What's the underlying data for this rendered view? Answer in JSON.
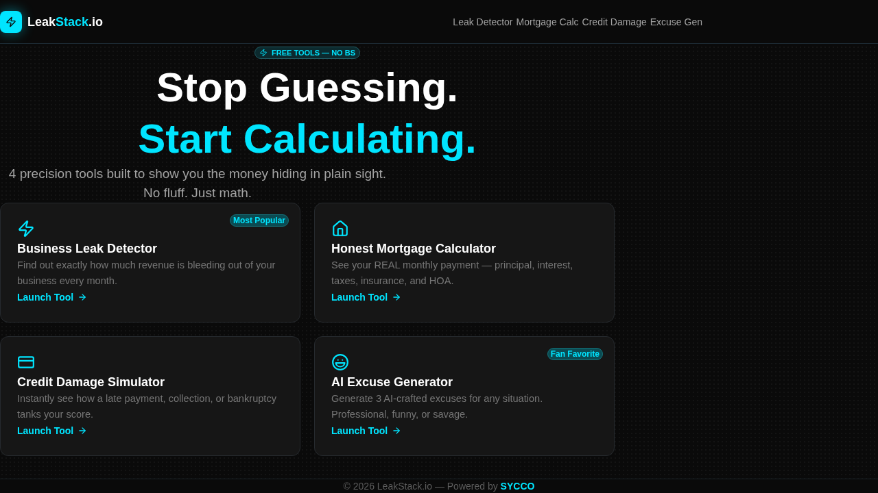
{
  "header": {
    "brand": [
      {
        "text": "Leak",
        "accent": false
      },
      {
        "text": "Stack",
        "accent": true
      },
      {
        "text": ".io",
        "accent": false
      }
    ],
    "nav": [
      "Leak Detector",
      "Mortgage Calc",
      "Credit Damage",
      "Excuse Gen"
    ]
  },
  "hero": {
    "tag": "FREE TOOLS — NO BS",
    "headline": [
      {
        "text": "Stop Guessing.",
        "accent": false
      },
      {
        "text": "Start Calculating.",
        "accent": true
      }
    ],
    "subtitle_lines": [
      "4 precision tools built to show you the money hiding in plain sight.",
      "No fluff. Just math."
    ]
  },
  "tools": [
    {
      "title": "Business Leak Detector",
      "description": "Find out exactly how much revenue is bleeding out of your business every month.",
      "link": "Launch Tool",
      "tag": "Most Popular"
    },
    {
      "title": "Honest Mortgage Calculator",
      "description": "See your REAL monthly payment — principal, interest, taxes, insurance, and HOA.",
      "link": "Launch Tool"
    },
    {
      "title": "Credit Damage Simulator",
      "description": "Instantly see how a late payment, collection, or bankruptcy tanks your score.",
      "link": "Launch Tool"
    },
    {
      "title": "AI Excuse Generator",
      "description": "Generate 3 AI-crafted excuses for any situation. Professional, funny, or savage.",
      "link": "Launch Tool",
      "tag": "Fan Favorite"
    }
  ],
  "footer": {
    "text": "© 2026 LeakStack.io — Powered by",
    "link": "SYCCO"
  }
}
